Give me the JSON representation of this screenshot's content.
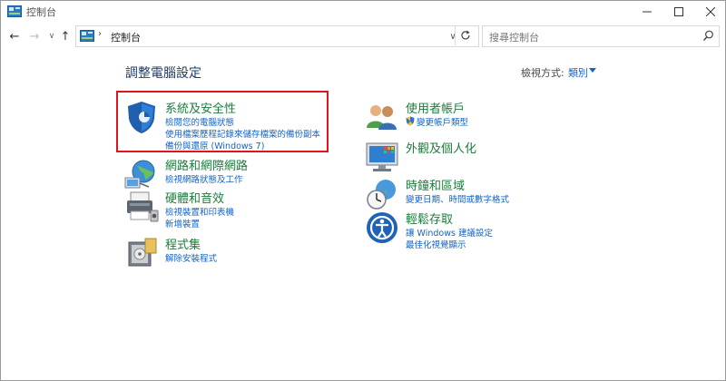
{
  "window": {
    "title": "控制台"
  },
  "address": {
    "path": "控制台"
  },
  "search": {
    "placeholder": "搜尋控制台"
  },
  "header": {
    "title": "調整電腦設定",
    "view_by_label": "檢視方式:",
    "view_by_value": "類別"
  },
  "categories_left": [
    {
      "title": "系統及安全性",
      "icon": "system-security-shield-icon",
      "links": [
        "檢閱您的電腦狀態",
        "使用檔案歷程記錄來儲存檔案的備份副本",
        "備份與還原 (Windows 7)"
      ]
    },
    {
      "title": "網路和網際網路",
      "icon": "network-globe-icon",
      "links": [
        "檢視網路狀態及工作"
      ]
    },
    {
      "title": "硬體和音效",
      "icon": "hardware-printer-icon",
      "links": [
        "檢視裝置和印表機",
        "新增裝置"
      ]
    },
    {
      "title": "程式集",
      "icon": "programs-icon",
      "links": [
        "解除安裝程式"
      ]
    }
  ],
  "categories_right": [
    {
      "title": "使用者帳戶",
      "icon": "user-accounts-icon",
      "links": [
        "變更帳戶類型"
      ]
    },
    {
      "title": "外觀及個人化",
      "icon": "appearance-monitor-icon",
      "links": []
    },
    {
      "title": "時鐘和區域",
      "icon": "clock-globe-icon",
      "links": [
        "變更日期、時間或數字格式"
      ]
    },
    {
      "title": "輕鬆存取",
      "icon": "ease-of-access-icon",
      "links": [
        "讓 Windows 建議設定",
        "最佳化視覺顯示"
      ]
    }
  ],
  "colors": {
    "category_title": "#1a7d3b",
    "link": "#1463c8",
    "highlight": "#e0141c",
    "page_title": "#1e3b6e"
  }
}
